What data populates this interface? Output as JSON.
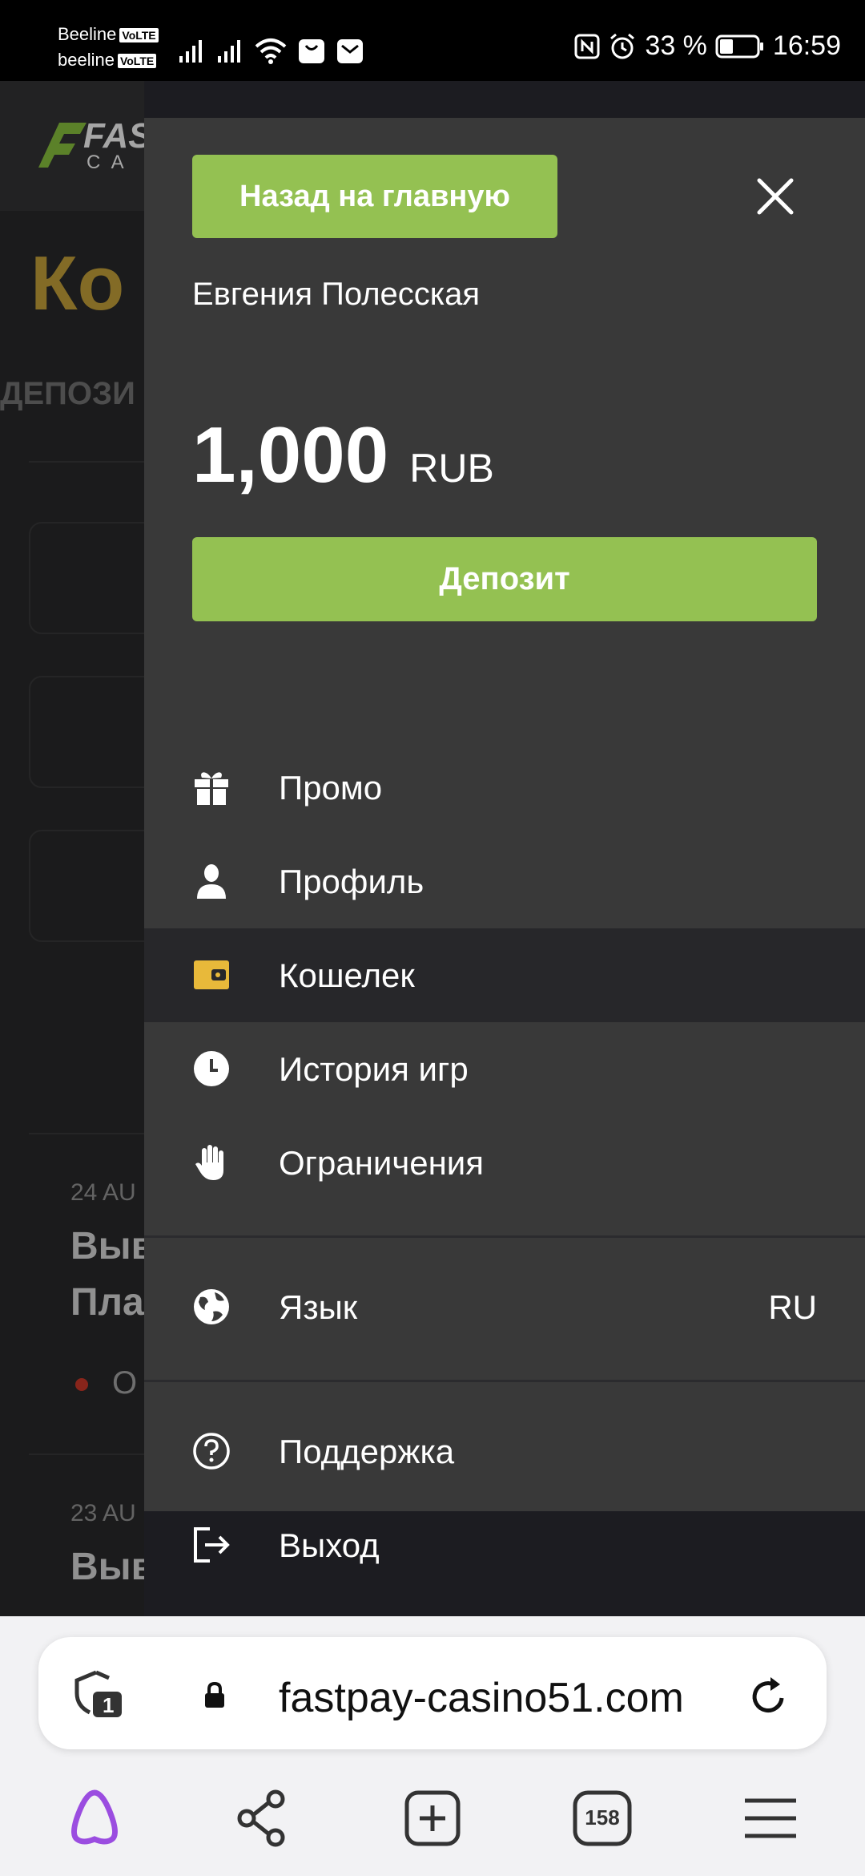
{
  "status_bar": {
    "carrier1": "Beeline",
    "carrier2": "beeline",
    "volte": "VoLTE",
    "battery_percent": "33 %",
    "time": "16:59"
  },
  "background_page": {
    "logo_text": "FAS",
    "logo_sub": "C A",
    "title": "Ко",
    "tab": "ДЕПОЗИ",
    "entries": [
      {
        "date": "24 AU",
        "title_line1": "Выв",
        "title_line2": "Пла",
        "status": "О"
      },
      {
        "date": "23 AU",
        "title_line1": "Выв"
      }
    ]
  },
  "drawer": {
    "back_button": "Назад на главную",
    "user_name": "Евгения Полесская",
    "balance_amount": "1,000",
    "balance_currency": "RUB",
    "deposit_button": "Депозит",
    "menu": [
      {
        "label": "Промо",
        "icon": "gift-icon"
      },
      {
        "label": "Профиль",
        "icon": "user-icon"
      },
      {
        "label": "Кошелек",
        "icon": "wallet-icon",
        "active": true
      },
      {
        "label": "История игр",
        "icon": "clock-icon"
      },
      {
        "label": "Ограничения",
        "icon": "hand-icon"
      }
    ],
    "language": {
      "label": "Язык",
      "value": "RU",
      "icon": "globe-icon"
    },
    "support": {
      "label": "Поддержка",
      "icon": "question-icon"
    },
    "logout": {
      "label": "Выход",
      "icon": "logout-icon"
    }
  },
  "browser": {
    "url": "fastpay-casino51.com",
    "shield_count": "1",
    "tabs_count": "158"
  },
  "colors": {
    "accent_green": "#94c152",
    "wallet_yellow": "#e8b93a",
    "gold_title": "#c9a53b"
  }
}
